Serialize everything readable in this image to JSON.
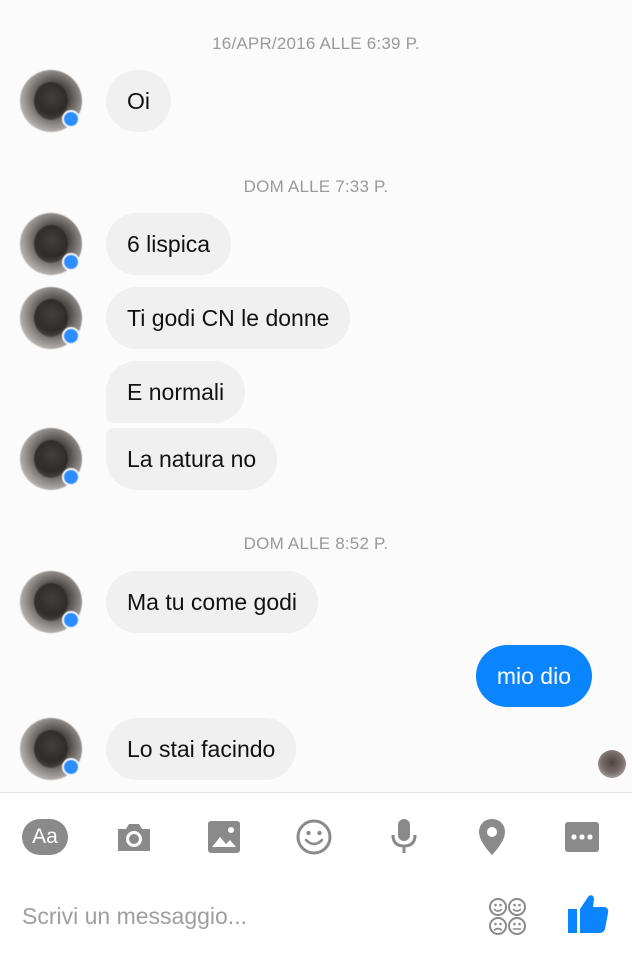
{
  "conversation": {
    "timestamps": [
      "16/APR/2016 ALLE 6:39 P.",
      "DOM ALLE 7:33 P.",
      "DOM ALLE 8:52 P."
    ],
    "messages": [
      {
        "text": "Oi",
        "direction": "incoming"
      },
      {
        "text": "6 lispica",
        "direction": "incoming"
      },
      {
        "text": "Ti godi CN le donne",
        "direction": "incoming"
      },
      {
        "text": "E normali",
        "direction": "incoming"
      },
      {
        "text": "La natura no",
        "direction": "incoming"
      },
      {
        "text": "Ma tu come godi",
        "direction": "incoming"
      },
      {
        "text": "mio dio",
        "direction": "outgoing"
      },
      {
        "text": "Lo stai facindo",
        "direction": "incoming"
      }
    ]
  },
  "composer": {
    "placeholder": "Scrivi un messaggio...",
    "text_button_label": "Aa",
    "tools": [
      "text-format-icon",
      "camera-icon",
      "gallery-icon",
      "emoji-icon",
      "microphone-icon",
      "location-icon",
      "more-icon"
    ],
    "like_icon": "thumbs-up-icon",
    "sticker_icon": "stickers-icon"
  },
  "colors": {
    "incoming_bubble": "#f0f0f0",
    "outgoing_bubble": "#0a84ff",
    "accent": "#0a84ff",
    "tool_icon": "#8a8a8a",
    "timestamp": "#9a9a9a"
  }
}
